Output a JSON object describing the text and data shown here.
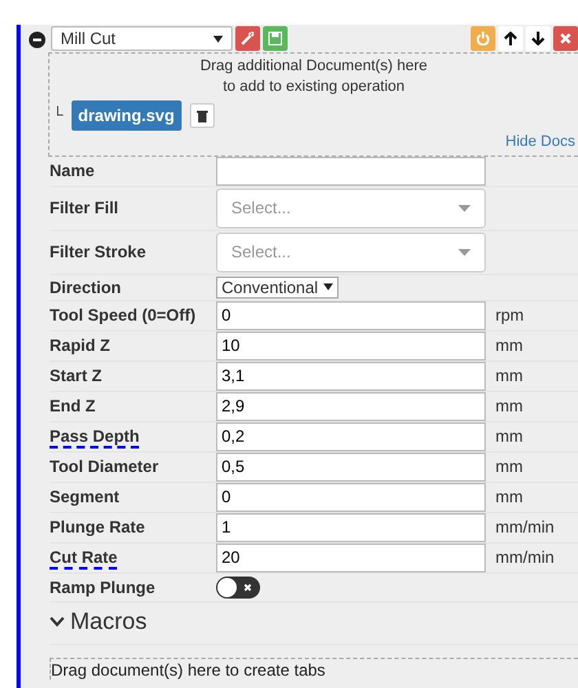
{
  "operation": {
    "type": "Mill Cut",
    "expanded": true
  },
  "docs_drop": {
    "line_1": "Drag additional Document(s) here",
    "line_2": "to add to existing operation",
    "tree_mark": "└",
    "documents": [
      "drawing.svg"
    ],
    "hide_link": "Hide Docs"
  },
  "fields": [
    {
      "kind": "text",
      "label": "Name",
      "underlined": false
    },
    {
      "kind": "select",
      "label": "Filter Fill",
      "underlined": false,
      "placeholder": "Select..."
    },
    {
      "kind": "select",
      "label": "Filter Stroke",
      "underlined": false,
      "placeholder": "Select..."
    },
    {
      "kind": "dropdown",
      "label": "Direction",
      "underlined": false,
      "value": "Conventional"
    },
    {
      "kind": "text",
      "label": "Tool Speed (0=Off)",
      "underlined": false,
      "value": "0",
      "unit": "rpm"
    },
    {
      "kind": "text",
      "label": "Rapid Z",
      "underlined": false,
      "value": "10",
      "unit": "mm"
    },
    {
      "kind": "text",
      "label": "Start Z",
      "underlined": false,
      "value": "3,1",
      "unit": "mm"
    },
    {
      "kind": "text",
      "label": "End Z",
      "underlined": false,
      "value": "2,9",
      "unit": "mm"
    },
    {
      "kind": "text",
      "label": "Pass Depth",
      "underlined": true,
      "value": "0,2",
      "unit": "mm"
    },
    {
      "kind": "text",
      "label": "Tool Diameter",
      "underlined": false,
      "value": "0,5",
      "unit": "mm"
    },
    {
      "kind": "text",
      "label": "Segment",
      "underlined": false,
      "value": "0",
      "unit": "mm"
    },
    {
      "kind": "text",
      "label": "Plunge Rate",
      "underlined": false,
      "value": "1",
      "unit": "mm/min"
    },
    {
      "kind": "text",
      "label": "Cut Rate",
      "underlined": true,
      "value": "20",
      "unit": "mm/min"
    },
    {
      "kind": "toggle",
      "label": "Ramp Plunge",
      "underlined": false,
      "on": false
    }
  ],
  "macros": {
    "label": "Macros",
    "expanded": false
  },
  "tabs_drop": {
    "text": "Drag document(s) here to create tabs"
  }
}
